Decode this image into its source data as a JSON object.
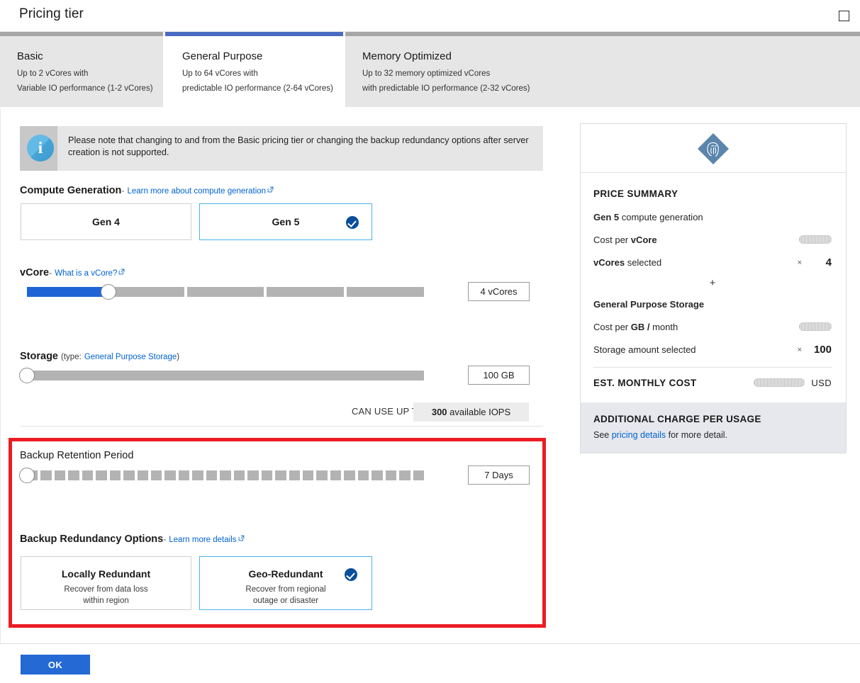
{
  "blade": {
    "title": "Pricing tier",
    "maximize_icon": "square-maximize-icon"
  },
  "tabs": [
    {
      "name": "basic",
      "label": "Basic",
      "sub1": "Up to 2 vCores with",
      "sub2": "Variable IO performance (1-2 vCores)",
      "active": false
    },
    {
      "name": "general-purpose",
      "label": "General Purpose",
      "sub1": "Up to 64 vCores with",
      "sub2": "predictable IO performance (2-64 vCores)",
      "active": true
    },
    {
      "name": "memory-optimized",
      "label": "Memory Optimized",
      "sub1": "Up to 32 memory optimized vCores",
      "sub2": "with predictable IO performance (2-32 vCores)",
      "active": false
    }
  ],
  "info_banner": {
    "icon": "info-icon",
    "message": "Please note that changing to and from the Basic pricing tier or changing the backup redundancy options after server creation is not supported."
  },
  "compute_generation": {
    "label": "Compute Generation",
    "dash": "-",
    "link": "Learn more about compute generation",
    "options": [
      {
        "name": "gen-4",
        "label": "Gen 4",
        "selected": false
      },
      {
        "name": "gen-5",
        "label": "Gen 5",
        "selected": true
      }
    ]
  },
  "vcore": {
    "label": "vCore",
    "dash": "-",
    "link": "What is a vCore?",
    "value_text": "4 vCores",
    "value": 4,
    "segments": 5,
    "filled_fraction": 0.205
  },
  "storage": {
    "label": "Storage",
    "type_prefix": "(type:",
    "type_link": "General Purpose Storage",
    "type_suffix": ")",
    "value_text": "100 GB",
    "value": 100,
    "filled_fraction": 0.0
  },
  "iops": {
    "prefix": "CAN USE UP TO",
    "amount": "300",
    "suffix": " available IOPS"
  },
  "backup_retention": {
    "label": "Backup Retention Period",
    "value_text": "7 Days",
    "value": 7,
    "segments": 29,
    "filled_fraction": 0.0
  },
  "backup_redundancy": {
    "label": "Backup Redundancy Options",
    "dash": "-",
    "link": "Learn more details",
    "options": [
      {
        "name": "locally-redundant",
        "label": "Locally Redundant",
        "sub1": "Recover from data loss",
        "sub2": "within region",
        "selected": false
      },
      {
        "name": "geo-redundant",
        "label": "Geo-Redundant",
        "sub1": "Recover from regional",
        "sub2": "outage or disaster",
        "selected": true
      }
    ]
  },
  "price_summary": {
    "logo_icon": "postgresql-elephant-icon",
    "heading": "PRICE SUMMARY",
    "compute_gen_bold": "Gen 5",
    "compute_gen_rest": " compute generation",
    "cost_per_vcore_prefix": "Cost per ",
    "cost_per_vcore_bold": "vCore",
    "cost_per_vcore_value": "",
    "vcores_bold": "vCores",
    "vcores_rest": " selected",
    "vcores_mult": "×",
    "vcores_value": "4",
    "plus": "+",
    "storage_heading": "General Purpose Storage",
    "cost_per_gb_prefix": "Cost per ",
    "cost_per_gb_bold": "GB /",
    "cost_per_gb_suffix": " month",
    "cost_per_gb_value": "",
    "storage_amount_label": "Storage amount selected",
    "storage_mult": "×",
    "storage_value": "100",
    "total_label": "EST. MONTHLY COST",
    "total_currency": "USD",
    "total_value": ""
  },
  "additional_charge": {
    "heading": "ADDITIONAL CHARGE PER USAGE",
    "text_before": "See ",
    "link": "pricing details",
    "text_after": " for more detail."
  },
  "footer": {
    "ok_label": "OK"
  },
  "highlight": {
    "name": "red-annotation-box",
    "color": "#ec1c24"
  },
  "colors": {
    "accent_blue": "#2469d4",
    "tab_active_bar": "#4a6bc1",
    "selected_border": "#48b4f0",
    "check_badge": "#0a4e9b",
    "slider_filled": "#1f64d6",
    "slider_track": "#b3b3b3",
    "link": "#0062d1"
  }
}
